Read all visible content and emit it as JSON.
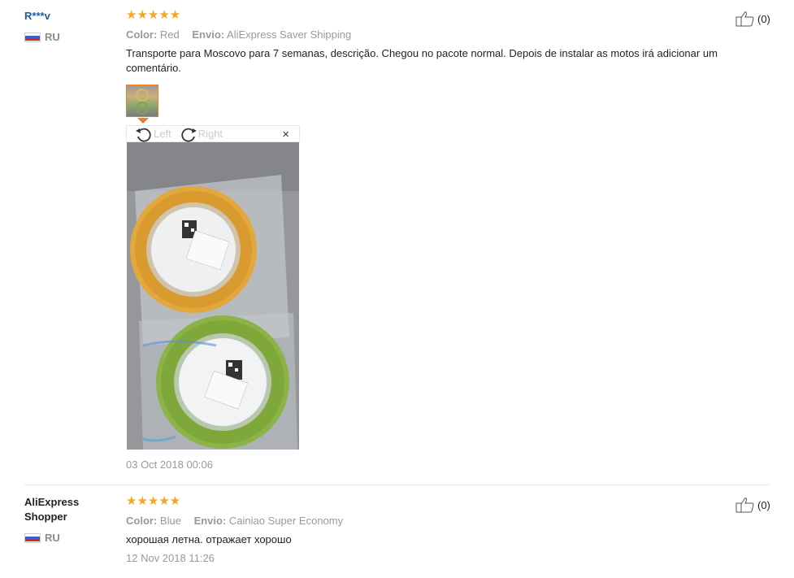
{
  "reviews": [
    {
      "user": "R***v",
      "country": "RU",
      "stars": "★★★★★",
      "color_label": "Color:",
      "color_value": "Red",
      "ship_label": "Envio:",
      "ship_value": "AliExpress Saver Shipping",
      "text": "Transporte para Moscovo para 7 semanas, descrição. Chegou no pacote normal. Depois de instalar as motos irá adicionar um comentário.",
      "date": "03 Oct 2018 00:06",
      "likes": "(0)",
      "viewer": {
        "left_label": "Left",
        "right_label": "Right",
        "close_label": "×"
      }
    },
    {
      "user": "AliExpress Shopper",
      "country": "RU",
      "stars": "★★★★★",
      "color_label": "Color:",
      "color_value": "Blue",
      "ship_label": "Envio:",
      "ship_value": "Cainiao Super Economy",
      "text": "хорошая летна. отражает хорошо",
      "date": "12 Nov 2018 11:26",
      "likes": "(0)"
    }
  ],
  "colors": {
    "star": "#f5a623",
    "user_link": "#1a5ea6",
    "accent": "#f07d2a"
  }
}
